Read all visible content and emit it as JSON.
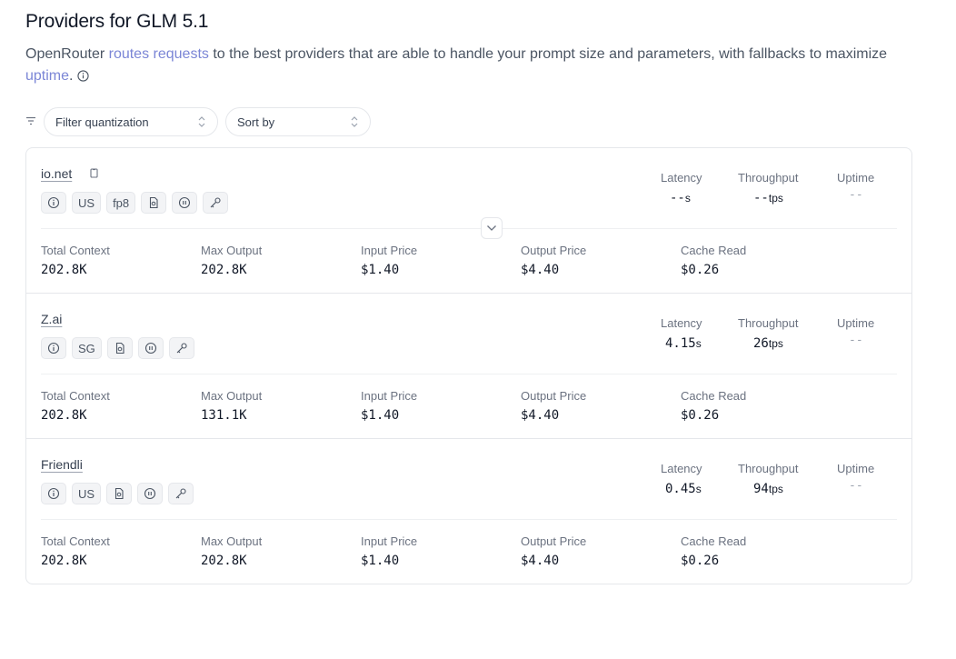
{
  "header": {
    "title": "Providers for GLM 5.1",
    "intro_prefix": "OpenRouter ",
    "intro_link1": "routes requests",
    "intro_middle": " to the best providers that are able to handle your prompt size and parameters, with fallbacks to maximize ",
    "intro_link2": "uptime",
    "intro_suffix": "."
  },
  "filters": {
    "quantization_placeholder": "Filter quantization",
    "sort_placeholder": "Sort by"
  },
  "labels": {
    "latency": "Latency",
    "throughput": "Throughput",
    "uptime": "Uptime",
    "total_context": "Total Context",
    "max_output": "Max Output",
    "input_price": "Input Price",
    "output_price": "Output Price",
    "cache_read": "Cache Read"
  },
  "providers": [
    {
      "name": "io.net",
      "region": "US",
      "quantization": "fp8",
      "latency": "--",
      "latency_unit": "s",
      "throughput": "--",
      "throughput_unit": "tps",
      "uptime": "--",
      "total_context": "202.8K",
      "max_output": "202.8K",
      "input_price": "$1.40",
      "output_price": "$4.40",
      "cache_read": "$0.26"
    },
    {
      "name": "Z.ai",
      "region": "SG",
      "latency": "4.15",
      "latency_unit": "s",
      "throughput": "26",
      "throughput_unit": "tps",
      "uptime": "--",
      "total_context": "202.8K",
      "max_output": "131.1K",
      "input_price": "$1.40",
      "output_price": "$4.40",
      "cache_read": "$0.26"
    },
    {
      "name": "Friendli",
      "region": "US",
      "latency": "0.45",
      "latency_unit": "s",
      "throughput": "94",
      "throughput_unit": "tps",
      "uptime": "--",
      "total_context": "202.8K",
      "max_output": "202.8K",
      "input_price": "$1.40",
      "output_price": "$4.40",
      "cache_read": "$0.26"
    }
  ],
  "icons": {
    "info": "info-icon",
    "filter": "filter-icon",
    "copy": "copy-icon",
    "document": "document-icon",
    "pause": "pause-icon",
    "key": "key-icon",
    "expand": "chevron-down-icon",
    "select_chevron": "chevron-updown-icon"
  },
  "colors": {
    "link": "#7b86d6",
    "border": "#e5e7eb",
    "chip_bg": "#f3f4f6"
  }
}
